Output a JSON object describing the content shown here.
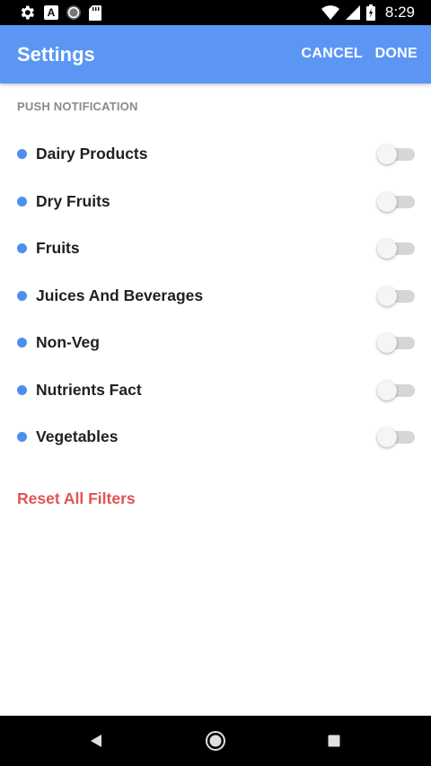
{
  "status_bar": {
    "time": "8:29",
    "left_icons": [
      "gear-icon",
      "a-app-icon",
      "circle-icon",
      "sd-card-icon"
    ],
    "right_icons": [
      "wifi-icon",
      "signal-icon",
      "battery-icon"
    ]
  },
  "app_bar": {
    "title": "Settings",
    "cancel_label": "CANCEL",
    "done_label": "DONE",
    "color": "#5b96f5"
  },
  "section": {
    "label": "PUSH NOTIFICATION"
  },
  "items": [
    {
      "label": "Dairy Products",
      "enabled": false
    },
    {
      "label": "Dry Fruits",
      "enabled": false
    },
    {
      "label": "Fruits",
      "enabled": false
    },
    {
      "label": "Juices And Beverages",
      "enabled": false
    },
    {
      "label": "Non-Veg",
      "enabled": false
    },
    {
      "label": "Nutrients Fact",
      "enabled": false
    },
    {
      "label": "Vegetables",
      "enabled": false
    }
  ],
  "reset_label": "Reset All Filters",
  "colors": {
    "accent": "#4f8ef0",
    "reset": "#e15453"
  },
  "nav_bar": {
    "icons": [
      "back-icon",
      "home-icon",
      "recents-icon"
    ]
  }
}
